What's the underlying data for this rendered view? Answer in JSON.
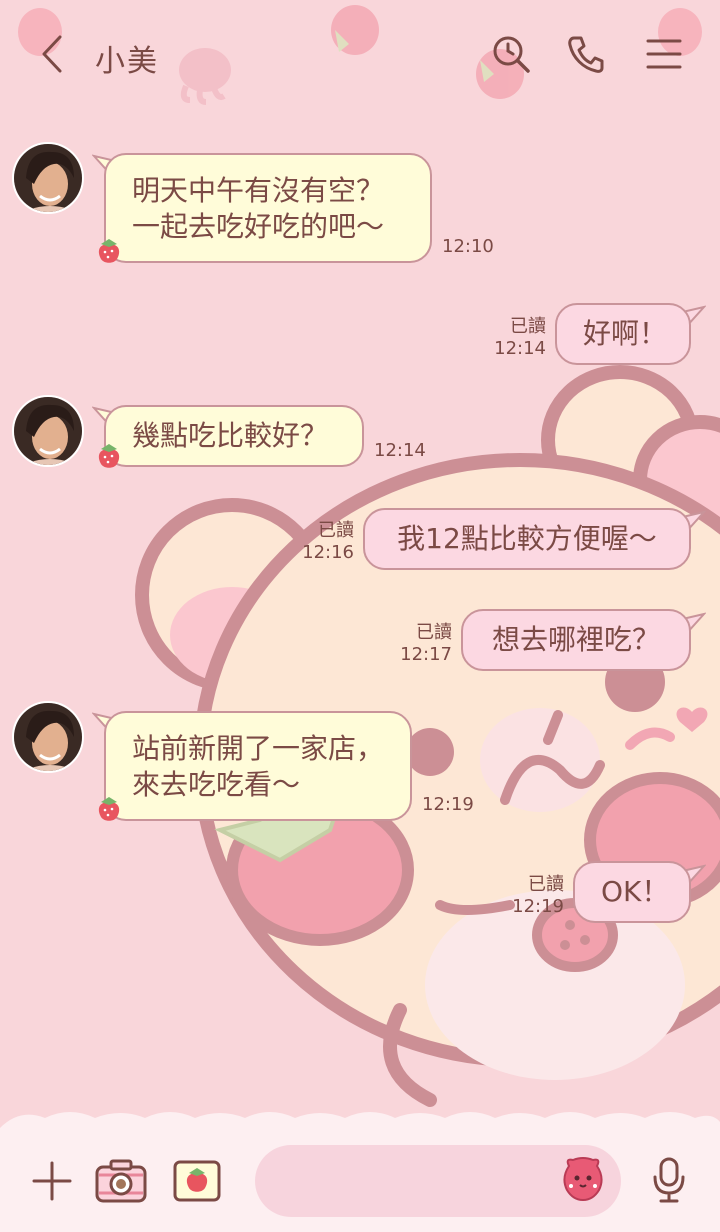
{
  "header": {
    "contact_name": "小美",
    "icons": [
      "back-icon",
      "search-icon",
      "phone-icon",
      "menu-icon"
    ]
  },
  "messages": [
    {
      "side": "in",
      "lines": [
        "明天中午有沒有空？",
        "一起去吃好吃的吧～"
      ],
      "time": "12:10"
    },
    {
      "side": "out",
      "lines": [
        "好啊！"
      ],
      "read": "已讀",
      "time": "12:14"
    },
    {
      "side": "in",
      "lines": [
        "幾點吃比較好？"
      ],
      "time": "12:14"
    },
    {
      "side": "out",
      "lines": [
        "我12點比較方便喔～"
      ],
      "read": "已讀",
      "time": "12:16"
    },
    {
      "side": "out",
      "lines": [
        "想去哪裡吃？"
      ],
      "read": "已讀",
      "time": "12:17"
    },
    {
      "side": "in",
      "lines": [
        "站前新開了一家店，",
        "來去吃吃看～"
      ],
      "time": "12:19"
    },
    {
      "side": "out",
      "lines": [
        "OK！"
      ],
      "read": "已讀",
      "time": "12:19"
    }
  ],
  "input_bar": {
    "placeholder": "",
    "icons": [
      "plus-icon",
      "camera-icon",
      "photo-icon",
      "sticker-icon",
      "microphone-icon"
    ]
  },
  "theme": {
    "background": "#f9d6da",
    "incoming_bubble": "#fffcd9",
    "outgoing_bubble": "#fcd8e2",
    "bubble_border": "#c9949a",
    "text": "#7b4a45"
  }
}
